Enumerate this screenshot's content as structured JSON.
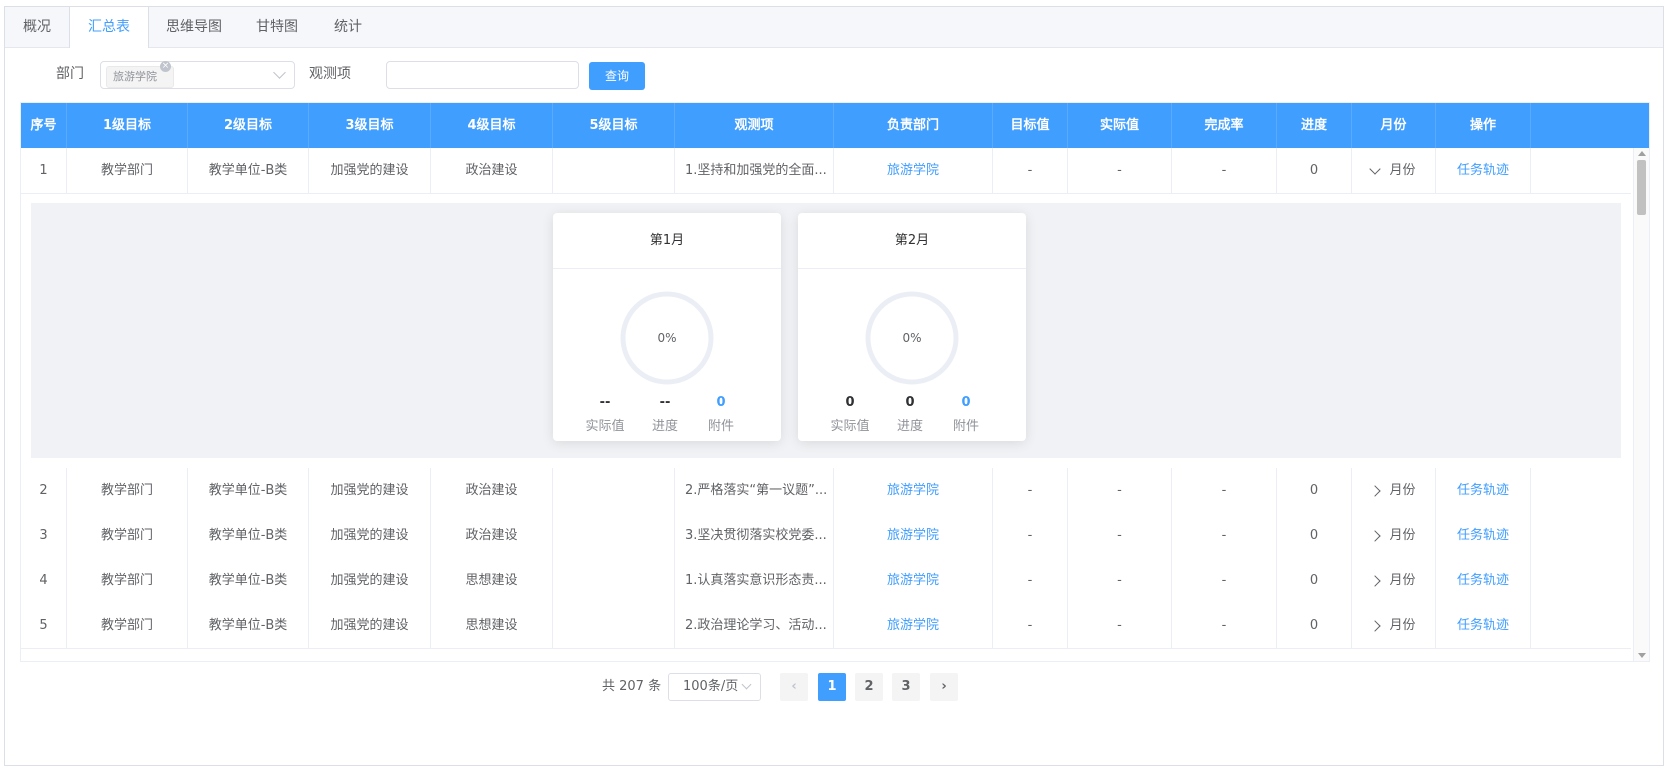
{
  "tabs": [
    {
      "label": "概况"
    },
    {
      "label": "汇总表"
    },
    {
      "label": "思维导图"
    },
    {
      "label": "甘特图"
    },
    {
      "label": "统计"
    }
  ],
  "filters": {
    "dept_label": "部门",
    "dept_tag": "旅游学院",
    "observe_label": "观测项",
    "observe_value": "",
    "query_button": "查询"
  },
  "table": {
    "headers": [
      "序号",
      "1级目标",
      "2级目标",
      "3级目标",
      "4级目标",
      "5级目标",
      "观测项",
      "负责部门",
      "目标值",
      "实际值",
      "完成率",
      "进度",
      "月份",
      "操作"
    ],
    "rows": [
      {
        "no": "1",
        "l1": "教学部门",
        "l2": "教学单位-B类",
        "l3": "加强党的建设",
        "l4": "政治建设",
        "l5": "",
        "observe": "1.坚持和加强党的全面...",
        "dept": "旅游学院",
        "target": "-",
        "actual": "-",
        "rate": "-",
        "progress": "0",
        "month": "月份",
        "op": "任务轨迹"
      },
      {
        "no": "2",
        "l1": "教学部门",
        "l2": "教学单位-B类",
        "l3": "加强党的建设",
        "l4": "政治建设",
        "l5": "",
        "observe": "2.严格落实“第一议题”...",
        "dept": "旅游学院",
        "target": "-",
        "actual": "-",
        "rate": "-",
        "progress": "0",
        "month": "月份",
        "op": "任务轨迹"
      },
      {
        "no": "3",
        "l1": "教学部门",
        "l2": "教学单位-B类",
        "l3": "加强党的建设",
        "l4": "政治建设",
        "l5": "",
        "observe": "3.坚决贯彻落实校党委...",
        "dept": "旅游学院",
        "target": "-",
        "actual": "-",
        "rate": "-",
        "progress": "0",
        "month": "月份",
        "op": "任务轨迹"
      },
      {
        "no": "4",
        "l1": "教学部门",
        "l2": "教学单位-B类",
        "l3": "加强党的建设",
        "l4": "思想建设",
        "l5": "",
        "observe": "1.认真落实意识形态责...",
        "dept": "旅游学院",
        "target": "-",
        "actual": "-",
        "rate": "-",
        "progress": "0",
        "month": "月份",
        "op": "任务轨迹"
      },
      {
        "no": "5",
        "l1": "教学部门",
        "l2": "教学单位-B类",
        "l3": "加强党的建设",
        "l4": "思想建设",
        "l5": "",
        "observe": "2.政治理论学习、活动...",
        "dept": "旅游学院",
        "target": "-",
        "actual": "-",
        "rate": "-",
        "progress": "0",
        "month": "月份",
        "op": "任务轨迹"
      }
    ],
    "expanded_months": [
      {
        "title": "第1月",
        "percent": "0%",
        "actual": "--",
        "progress": "--",
        "attach": "0",
        "actual_label": "实际值",
        "progress_label": "进度",
        "attach_label": "附件"
      },
      {
        "title": "第2月",
        "percent": "0%",
        "actual": "0",
        "progress": "0",
        "attach": "0",
        "actual_label": "实际值",
        "progress_label": "进度",
        "attach_label": "附件"
      }
    ]
  },
  "pagination": {
    "total": "共 207 条",
    "page_size": "100条/页",
    "pages": [
      "1",
      "2",
      "3"
    ],
    "current": "1"
  },
  "colors": {
    "primary": "#409eff",
    "panel_bg": "#f0f2f5"
  },
  "icons": [
    "chevron-down-icon",
    "chevron-right-icon",
    "prev-page-icon",
    "next-page-icon",
    "tag-close-icon"
  ]
}
